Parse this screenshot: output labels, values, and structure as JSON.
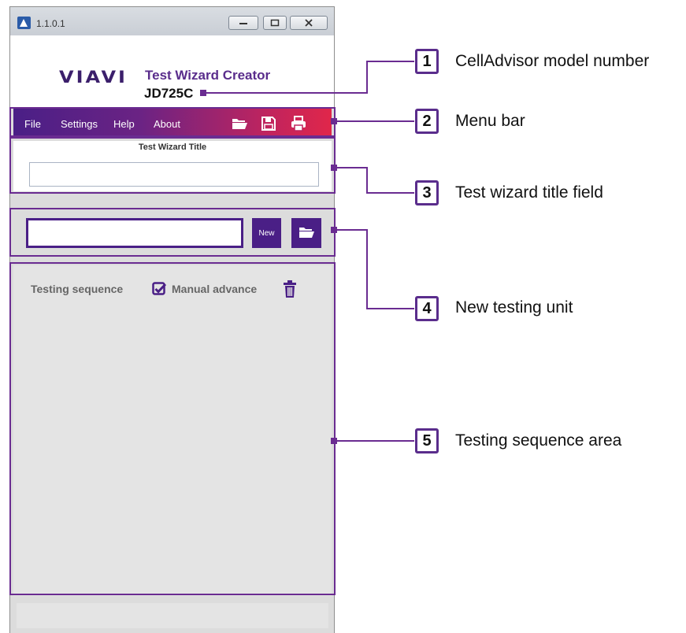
{
  "window": {
    "version": "1.1.0.1",
    "brand_logo": "VIAVI",
    "app_name": "Test Wizard Creator",
    "model_number": "JD725C"
  },
  "menu": {
    "items": [
      "File",
      "Settings",
      "Help",
      "About"
    ],
    "icons": [
      "folder-open-icon",
      "save-icon",
      "print-icon"
    ]
  },
  "title_panel": {
    "label": "Test Wizard Title",
    "value": ""
  },
  "unit_panel": {
    "input_value": "",
    "new_label": "New"
  },
  "sequence_panel": {
    "label": "Testing sequence",
    "manual_advance_label": "Manual advance",
    "manual_advance_checked": true
  },
  "callouts": [
    {
      "number": "1",
      "text": "CellAdvisor model number"
    },
    {
      "number": "2",
      "text": "Menu bar"
    },
    {
      "number": "3",
      "text": "Test wizard title field"
    },
    {
      "number": "4",
      "text": "New testing unit"
    },
    {
      "number": "5",
      "text": "Testing sequence area"
    }
  ],
  "colors": {
    "accent": "#4a1f86",
    "callout": "#6a2c91",
    "menubar_start": "#4a1f86",
    "menubar_end": "#e0264a"
  }
}
